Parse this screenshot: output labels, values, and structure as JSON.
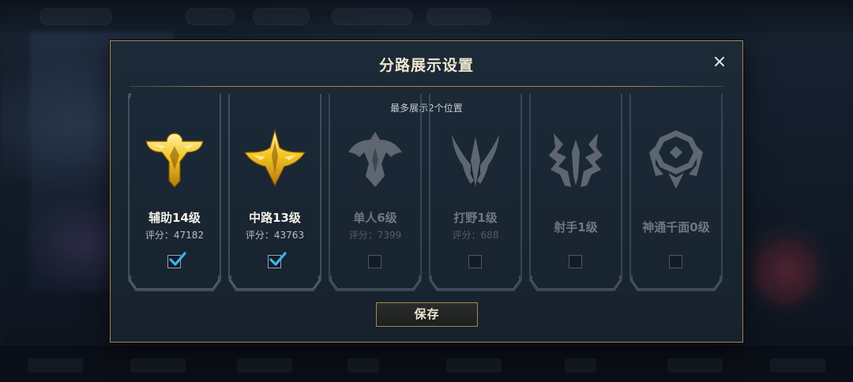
{
  "dialog": {
    "title": "分路展示设置",
    "subtitle": "最多展示2个位置",
    "close_icon": "×",
    "save_label": "保存"
  },
  "colors": {
    "gold": "#a5874e",
    "check_blue": "#39b6ef",
    "icon_gold": "#f5c523",
    "icon_gray": "#5d6671"
  },
  "cards": [
    {
      "name": "辅助14级",
      "score": "评分：47182",
      "checked": true,
      "icon": "support-role-icon"
    },
    {
      "name": "中路13级",
      "score": "评分：43763",
      "checked": true,
      "icon": "mid-lane-role-icon"
    },
    {
      "name": "单人6级",
      "score": "评分：7399",
      "checked": false,
      "icon": "solo-lane-role-icon"
    },
    {
      "name": "打野1级",
      "score": "评分：688",
      "checked": false,
      "icon": "jungle-role-icon"
    },
    {
      "name": "射手1级",
      "score": "",
      "checked": false,
      "icon": "marksman-role-icon"
    },
    {
      "name": "神通千面0级",
      "score": "",
      "checked": false,
      "icon": "versatile-role-icon"
    }
  ]
}
